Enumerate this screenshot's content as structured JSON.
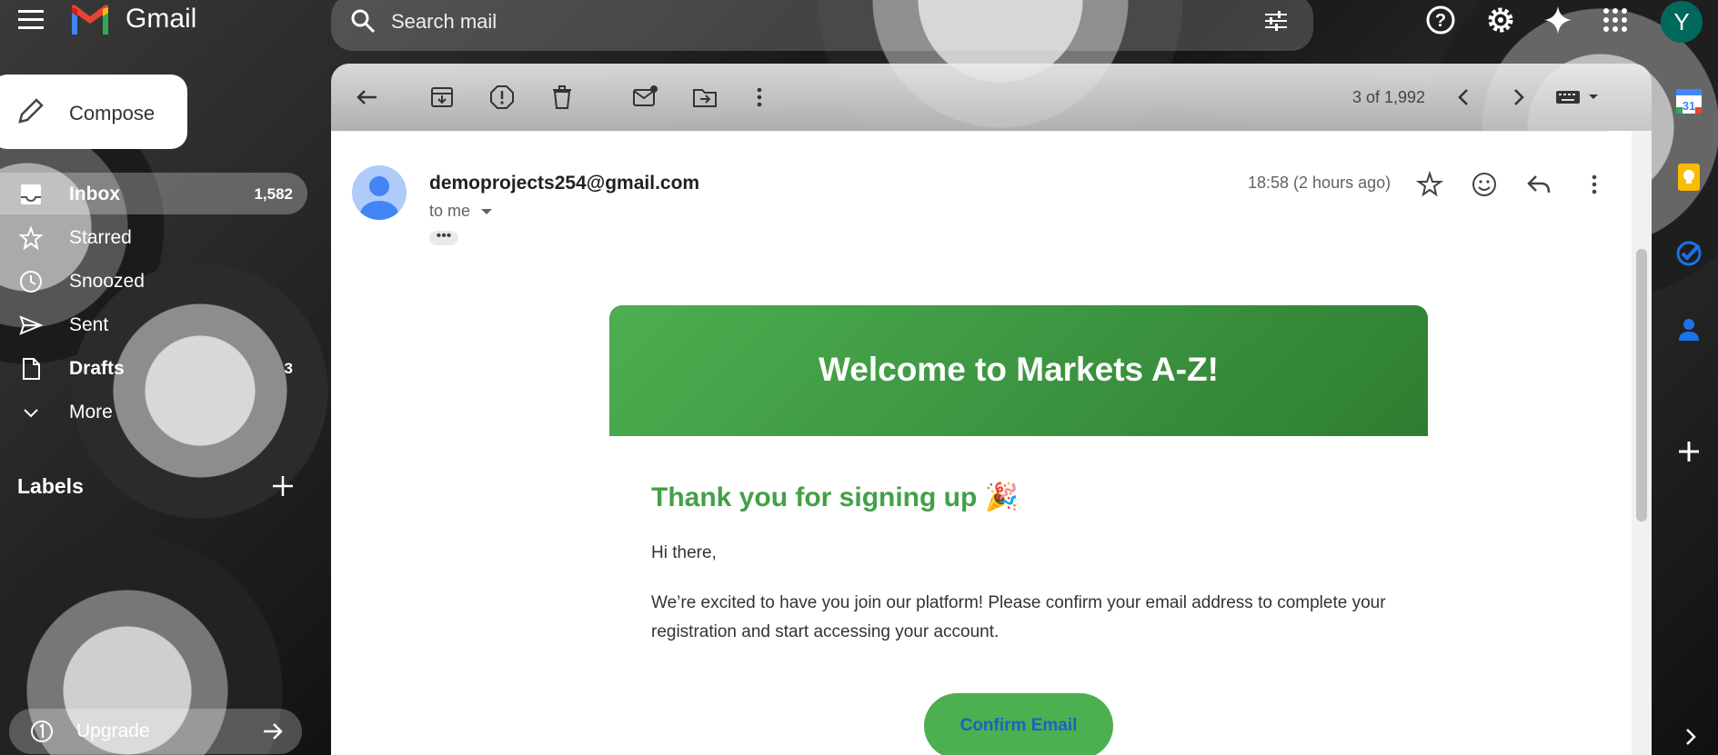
{
  "app": {
    "name": "Gmail"
  },
  "search": {
    "placeholder": "Search mail"
  },
  "compose": {
    "label": "Compose"
  },
  "sidebar": {
    "items": [
      {
        "label": "Inbox",
        "count": "1,582",
        "icon": "inbox-icon",
        "active": true
      },
      {
        "label": "Starred",
        "count": "",
        "icon": "star-icon"
      },
      {
        "label": "Snoozed",
        "count": "",
        "icon": "clock-icon"
      },
      {
        "label": "Sent",
        "count": "",
        "icon": "send-icon"
      },
      {
        "label": "Drafts",
        "count": "3",
        "icon": "draft-icon"
      },
      {
        "label": "More",
        "count": "",
        "icon": "chevron-down-icon"
      }
    ],
    "labels_title": "Labels",
    "upgrade_label": "Upgrade"
  },
  "header": {
    "avatar_letter": "Y"
  },
  "toolbar": {
    "pager": "3 of 1,992"
  },
  "message": {
    "sender": "demoprojects254@gmail.com",
    "recipient": "to me",
    "time": "18:58 (2 hours ago)",
    "banner_title": "Welcome to Markets A-Z!",
    "heading": "Thank you for signing up 🎉",
    "greeting": "Hi there,",
    "body": "We’re excited to have you join our platform! Please confirm your email address to complete your registration and start accessing your account.",
    "button_label": "Confirm Email"
  },
  "colors": {
    "banner_green": "#43a047",
    "heading_green": "#43a047",
    "button_green": "#4caf50",
    "button_text": "#1565c0",
    "avatar_bg": "#00695c"
  }
}
